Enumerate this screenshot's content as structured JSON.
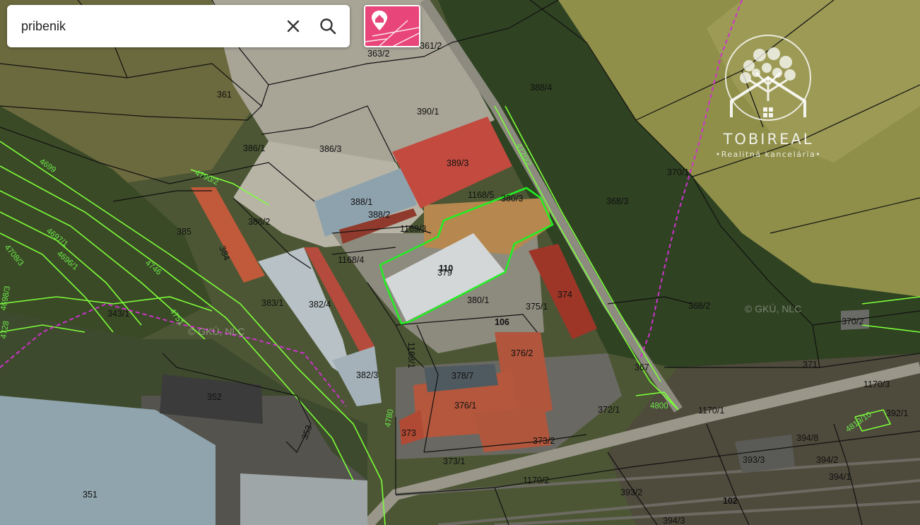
{
  "search": {
    "value": "pribenik"
  },
  "controls": {
    "clear_icon": "close-icon",
    "search_icon": "search-icon",
    "layer_icon": "cadastre-map-pin-icon",
    "layer_color": "#e8467a"
  },
  "branding": {
    "name": "TOBIREAL",
    "tagline": "•Realitná kancelária•"
  },
  "watermark": [
    "© GKÚ, NLC",
    "© GKÚ, NLC"
  ],
  "colors": {
    "parcel_border": "#111111",
    "highlight": "#22ee22",
    "land_registry": "#7dff3a",
    "boundary": "#cc33cc"
  },
  "parcels": [
    "361",
    "386/1",
    "386/3",
    "386/2",
    "385",
    "384",
    "383/1",
    "382/4",
    "382/3",
    "343/1",
    "352",
    "351",
    "353",
    "363/2",
    "361/2",
    "390/1",
    "389/3",
    "388/1",
    "388/2",
    "1168/5",
    "1169/3",
    "1168/4",
    "380/3",
    "379",
    "380/1",
    "375/1",
    "374",
    "376/2",
    "378/7",
    "376/1",
    "1168/1",
    "373",
    "372/1",
    "373/1",
    "373/2",
    "1170/2",
    "388/4",
    "368/3",
    "368/2",
    "370/1",
    "370/2",
    "371",
    "367",
    "1170/3",
    "1170/1",
    "392/1",
    "394/8",
    "393/3",
    "394/2",
    "394/1",
    "393/2",
    "394/3"
  ],
  "building_numbers": [
    "110",
    "106"
  ],
  "road_number": "102",
  "registry_labels": [
    "4790/2",
    "4708/3",
    "4699",
    "4697/1",
    "4698/3",
    "4696/1",
    "4746",
    "4751",
    "4728",
    "4780",
    "4720/2",
    "4800",
    "4819/10"
  ]
}
